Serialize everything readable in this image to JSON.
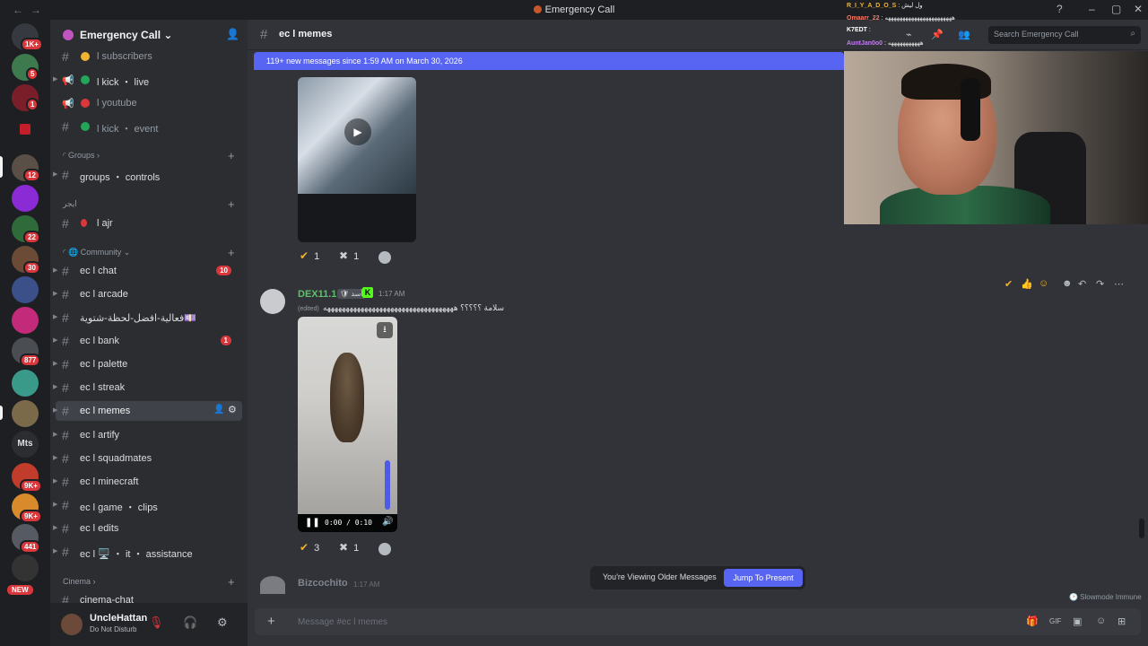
{
  "window": {
    "title": "Emergency Call",
    "back": "←",
    "forward": "→",
    "min": "–",
    "max": "▢",
    "close": "✕",
    "help": "?"
  },
  "guild": {
    "name": "Emergency Call ⌄"
  },
  "rail": {
    "servers": [
      {
        "badge": "1K+"
      },
      {
        "badge": "5"
      },
      {
        "badge": "1"
      },
      {
        "badge": ""
      },
      {
        "badge": "12"
      },
      {
        "badge": ""
      },
      {
        "badge": "22"
      },
      {
        "badge": "30"
      },
      {
        "badge": ""
      },
      {
        "badge": ""
      },
      {
        "badge": "877"
      },
      {
        "badge": ""
      },
      {
        "badge": ""
      },
      {
        "badge": ""
      },
      {
        "badge": "9K+"
      },
      {
        "badge": "9K+"
      },
      {
        "badge": "441"
      }
    ],
    "mts": "Mts",
    "new_badge": "NEW"
  },
  "sidebar": {
    "channels": [
      {
        "label": "l subscribers",
        "kind": "announce",
        "emoji": "#f0b232"
      },
      {
        "label": "l kick ・ live",
        "kind": "announce",
        "emoji": "#23a55a",
        "bright": true
      },
      {
        "label": "l youtube",
        "kind": "announce",
        "emoji": "#da373c"
      },
      {
        "label": "l kick ・ event",
        "kind": "text",
        "emoji": "#23a55a"
      }
    ],
    "categories": {
      "groups": "◜ Groups ›",
      "ajr": "ايجر",
      "community": "◜ 🌐 Community ⌄",
      "cinema": "Cinema ›"
    },
    "groups_channels": [
      {
        "label": "groups ・ controls"
      }
    ],
    "ajr_channels": [
      {
        "label": "l ajr"
      }
    ],
    "community_channels": [
      {
        "label": "ec l chat",
        "count": "10"
      },
      {
        "label": "ec l arcade",
        "count": ""
      },
      {
        "label": "فعالية-افضل-لحظة-شتوية💷",
        "count": ""
      },
      {
        "label": "ec l bank",
        "count": "1"
      },
      {
        "label": "ec l palette",
        "count": ""
      },
      {
        "label": "ec l streak",
        "count": ""
      },
      {
        "label": "ec l memes",
        "count": "",
        "active": true
      },
      {
        "label": "ec l artify",
        "count": ""
      },
      {
        "label": "ec l squadmates",
        "count": ""
      },
      {
        "label": "ec l minecraft",
        "count": ""
      },
      {
        "label": "ec l game ・ clips",
        "count": ""
      },
      {
        "label": "ec l edits",
        "count": ""
      },
      {
        "label": "ec l 🖥️ ・ it ・ assistance",
        "count": ""
      }
    ],
    "cinema_channels": [
      {
        "label": "cinema-chat"
      }
    ],
    "user": {
      "name": "UncleHattan",
      "status": "Do Not Disturb"
    }
  },
  "chat": {
    "channel": "ec l memes",
    "search_placeholder": "Search Emergency Call",
    "new_messages_bar": "119+ new messages since 1:59 AM on March 30, 2026",
    "media1_reactions": [
      {
        "emoji": "✔",
        "count": "1"
      },
      {
        "emoji": "✖",
        "count": "1"
      }
    ],
    "message": {
      "author": "DEX11.1",
      "tag": "🛡 أسد",
      "time": "1:17 AM",
      "edited": "(edited)",
      "text": "سلامة ؟؟؟؟؟ هههههههههههههههههههههههههههههههههههه",
      "video_time": "0:00 / 0:10",
      "reactions": [
        {
          "emoji": "✔",
          "count": "3"
        },
        {
          "emoji": "✖",
          "count": "1"
        }
      ]
    },
    "next_message": {
      "author": "Bizcochito",
      "time": "1:17 AM"
    },
    "older_banner": {
      "text": "You're Viewing Older Messages",
      "button": "Jump To Present"
    },
    "slowmode": "🕑 Slowmode Immune",
    "composer_placeholder": "Message #ec l memes"
  },
  "overlay": {
    "chat_lines": [
      {
        "name": "R_I_Y_A_D_O_S",
        "text": ": ول ليش",
        "color": "#f0b232"
      },
      {
        "name": "Omaarr_22",
        "text": ": هههههههههههههههههههههههه",
        "color": "#f47b67"
      },
      {
        "name": "K7EDT",
        "text": ":",
        "color": "#ffffff"
      },
      {
        "name": "AuntJan0o0",
        "text": ": هههههههههههه",
        "color": "#c27cf2"
      }
    ]
  }
}
